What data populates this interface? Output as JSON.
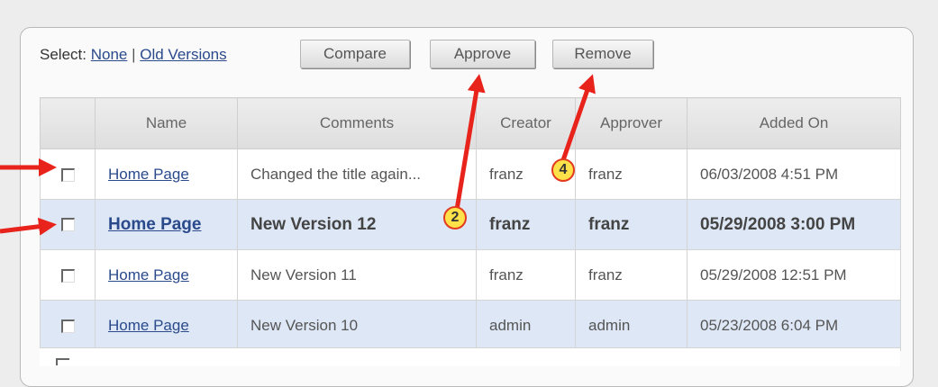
{
  "toolbar": {
    "select_label": "Select:",
    "link_none": "None",
    "separator": "|",
    "link_old_versions": "Old Versions",
    "compare_label": "Compare",
    "approve_label": "Approve",
    "remove_label": "Remove"
  },
  "table": {
    "headers": [
      "",
      "Name",
      "Comments",
      "Creator",
      "Approver",
      "Added On"
    ],
    "rows": [
      {
        "name": "Home Page",
        "comment": "Changed the title again...",
        "creator": "franz",
        "approver": "franz",
        "added": "06/03/2008 4:51 PM"
      },
      {
        "name": "Home Page",
        "comment": "New Version 12",
        "creator": "franz",
        "approver": "franz",
        "added": "05/29/2008 3:00 PM"
      },
      {
        "name": "Home Page",
        "comment": "New Version 11",
        "creator": "franz",
        "approver": "franz",
        "added": "05/29/2008 12:51 PM"
      },
      {
        "name": "Home Page",
        "comment": "New Version 10",
        "creator": "admin",
        "approver": "admin",
        "added": "05/23/2008 6:04 PM"
      }
    ]
  },
  "annotations": {
    "badge_approve": "2",
    "badge_remove": "4",
    "arrow_color": "#e8231b",
    "badge_color": "#ffe14a"
  }
}
